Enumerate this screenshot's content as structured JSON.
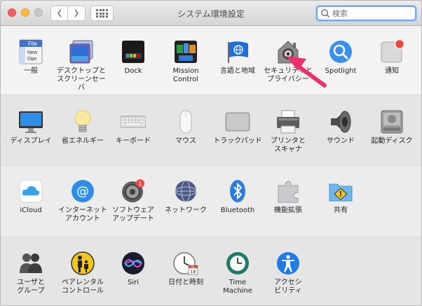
{
  "window": {
    "title": "システム環境設定",
    "search_placeholder": "検索"
  },
  "rows": [
    {
      "items": [
        {
          "label1": "一般",
          "label2": "",
          "icon": "general-icon"
        },
        {
          "label1": "デスクトップと",
          "label2": "スクリーンセーバ",
          "icon": "desktop-icon"
        },
        {
          "label1": "Dock",
          "label2": "",
          "icon": "dock-icon"
        },
        {
          "label1": "Mission",
          "label2": "Control",
          "icon": "mission-control-icon"
        },
        {
          "label1": "言語と地域",
          "label2": "",
          "icon": "language-flag-icon"
        },
        {
          "label1": "セキュリティと",
          "label2": "プライバシー",
          "icon": "security-house-icon"
        },
        {
          "label1": "Spotlight",
          "label2": "",
          "icon": "spotlight-icon"
        },
        {
          "label1": "通知",
          "label2": "",
          "icon": "notifications-icon"
        }
      ]
    },
    {
      "items": [
        {
          "label1": "ディスプレイ",
          "label2": "",
          "icon": "display-icon"
        },
        {
          "label1": "省エネルギー",
          "label2": "",
          "icon": "lightbulb-icon"
        },
        {
          "label1": "キーボード",
          "label2": "",
          "icon": "keyboard-icon"
        },
        {
          "label1": "マウス",
          "label2": "",
          "icon": "mouse-icon"
        },
        {
          "label1": "トラックパッド",
          "label2": "",
          "icon": "trackpad-icon"
        },
        {
          "label1": "プリンタと",
          "label2": "スキャナ",
          "icon": "printer-icon"
        },
        {
          "label1": "サウンド",
          "label2": "",
          "icon": "speaker-icon"
        },
        {
          "label1": "起動ディスク",
          "label2": "",
          "icon": "disk-icon"
        }
      ]
    },
    {
      "items": [
        {
          "label1": "iCloud",
          "label2": "",
          "icon": "icloud-icon"
        },
        {
          "label1": "インターネット",
          "label2": "アカウント",
          "icon": "internet-accounts-icon"
        },
        {
          "label1": "ソフトウェア",
          "label2": "アップデート",
          "icon": "software-update-icon",
          "badge": "1"
        },
        {
          "label1": "ネットワーク",
          "label2": "",
          "icon": "network-globe-icon"
        },
        {
          "label1": "Bluetooth",
          "label2": "",
          "icon": "bluetooth-icon"
        },
        {
          "label1": "機能拡張",
          "label2": "",
          "icon": "extensions-icon"
        },
        {
          "label1": "共有",
          "label2": "",
          "icon": "sharing-folder-icon"
        }
      ]
    },
    {
      "items": [
        {
          "label1": "ユーザと",
          "label2": "グループ",
          "icon": "users-icon"
        },
        {
          "label1": "ペアレンタル",
          "label2": "コントロール",
          "icon": "parental-controls-icon"
        },
        {
          "label1": "Siri",
          "label2": "",
          "icon": "siri-icon"
        },
        {
          "label1": "日付と時刻",
          "label2": "",
          "icon": "clock-icon"
        },
        {
          "label1": "Time",
          "label2": "Machine",
          "icon": "time-machine-icon"
        },
        {
          "label1": "アクセシ",
          "label2": "ビリティ",
          "icon": "accessibility-icon"
        }
      ]
    }
  ],
  "texts": {
    "general_icon_text1": "File",
    "general_icon_text2": "New",
    "general_icon_text3": "Ope",
    "calendar_month": "JUL",
    "calendar_day": "18"
  }
}
